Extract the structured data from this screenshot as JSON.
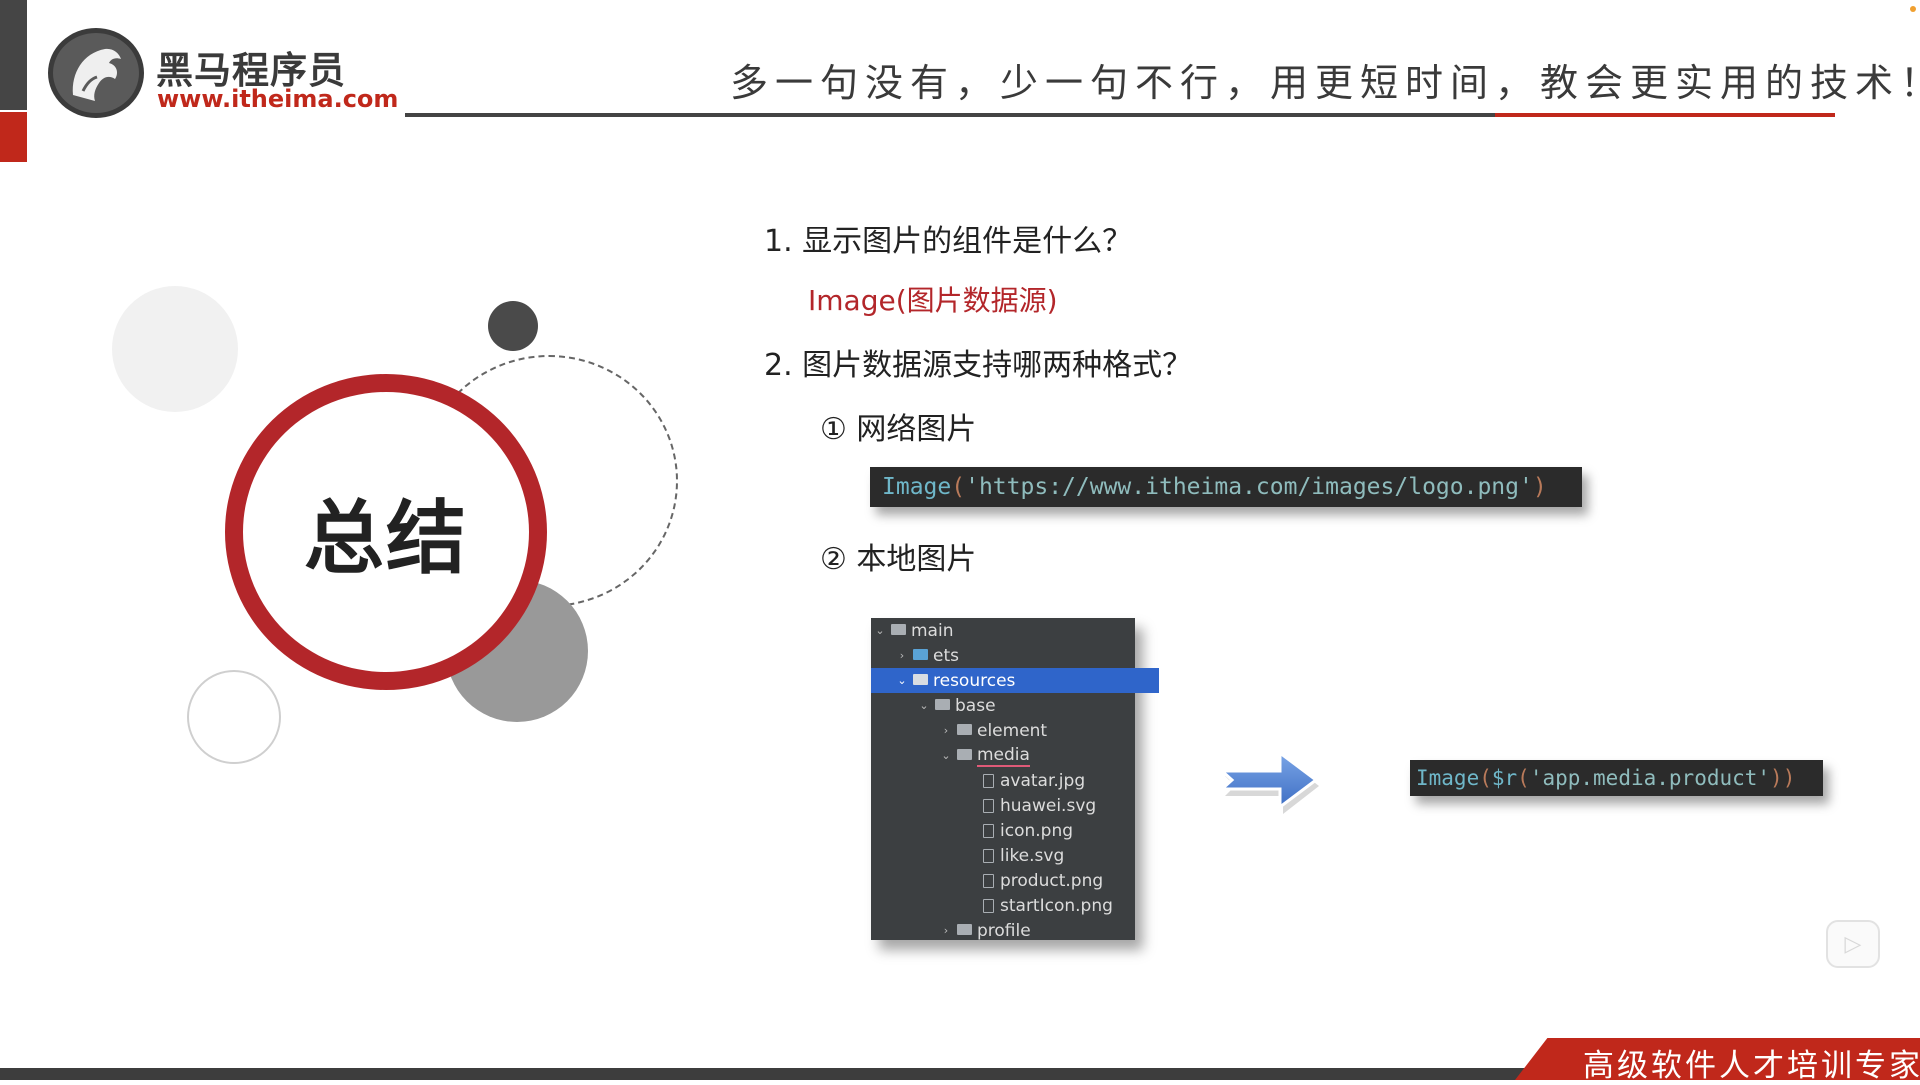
{
  "header": {
    "logo_name": "黑马程序员",
    "logo_url": "www.itheima.com",
    "slogan": "多一句没有，少一句不行，用更短时间，教会更实用的技术！"
  },
  "left_graphic": {
    "title": "总结"
  },
  "content": {
    "q1": "1.  显示图片的组件是什么？",
    "a1": "Image(图片数据源)",
    "q2": "2.   图片数据源支持哪两种格式？",
    "opt1": "① 网络图片",
    "code1": {
      "fn": "Image",
      "open": "(",
      "arg": "'https://www.itheima.com/images/logo.png'",
      "close": ")"
    },
    "opt2": "② 本地图片",
    "code2": {
      "fn": "Image",
      "open": "(",
      "r": "$r",
      "open2": "(",
      "arg": "'app.media.product'",
      "close": "))"
    }
  },
  "file_tree": [
    {
      "label": "main",
      "chevron": "⌄"
    },
    {
      "label": "ets",
      "chevron": "›"
    },
    {
      "label": "resources",
      "chevron": "⌄"
    },
    {
      "label": "base",
      "chevron": "⌄"
    },
    {
      "label": "element",
      "chevron": "›"
    },
    {
      "label": "media",
      "chevron": "⌄"
    },
    {
      "label": "avatar.jpg"
    },
    {
      "label": "huawei.svg"
    },
    {
      "label": "icon.png"
    },
    {
      "label": "like.svg"
    },
    {
      "label": "product.png"
    },
    {
      "label": "startIcon.png"
    },
    {
      "label": "profile",
      "chevron": "›"
    }
  ],
  "footer": {
    "tagline": "高级软件人才培训专家"
  },
  "colors": {
    "brand_red": "#c0281b",
    "circle_red": "#b3262a",
    "selection_blue": "#2f65ca",
    "arrow_blue": "#4a7fd0"
  }
}
